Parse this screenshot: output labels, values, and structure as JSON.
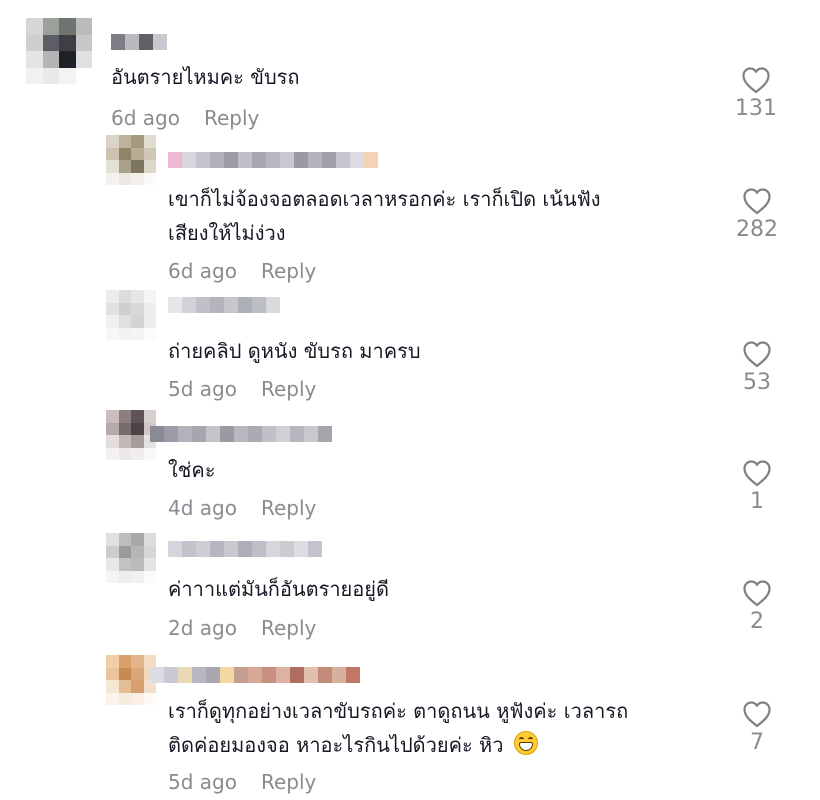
{
  "comments": [
    {
      "text_lines": [
        "อันตรายไหมคะ ขับรถ"
      ],
      "time": "6d ago",
      "reply_label": "Reply",
      "likes": "131",
      "avatar_colors": [
        "#d6d6d6",
        "#9aa09a",
        "#6f7470",
        "#b9bcb9",
        "#cfcfcf",
        "#5d5d66",
        "#3d3f45",
        "#c8c8c8",
        "#e4e4e4",
        "#b4b4b4",
        "#1f2128",
        "#e0e0e0",
        "#f1f1f1",
        "#e9e9e9",
        "#f3f3f3",
        "#ffffff"
      ],
      "name_colors": [
        "#7d7d86",
        "#b9b9c0",
        "#5f6068",
        "#c8c8ce"
      ]
    },
    {
      "text_lines": [
        "เขาก็ไม่จ้องจอตลอดเวลาหรอกค่ะ เราก็เปิด เน้นฟัง",
        "เสียงให้ไม่ง่วง"
      ],
      "time": "6d ago",
      "reply_label": "Reply",
      "likes": "282",
      "avatar_colors": [
        "#d9d3c8",
        "#bdb39d",
        "#a49a80",
        "#e2dcd0",
        "#cbc3b0",
        "#8f8468",
        "#b7ad94",
        "#d0c8b6",
        "#e6e1d6",
        "#a9a08a",
        "#7d7560",
        "#ddd7ca",
        "#f4f2ee",
        "#ece9e2",
        "#f2efea",
        "#fafaf8"
      ],
      "name_colors": [
        "#efb8d2",
        "#d6d6dc",
        "#c4c4cc",
        "#b0b0b8",
        "#9c9ca6",
        "#c0c0c8",
        "#a8a8b2",
        "#b8b8c0",
        "#c8c8d0",
        "#9a9aa4",
        "#b4b4bc",
        "#a0a0aa",
        "#c6c6ce",
        "#dcdce2",
        "#f2d3b6"
      ]
    },
    {
      "text_lines": [
        "ถ่ายคลิป ดูหนัง ขับรถ มาครบ"
      ],
      "time": "5d ago",
      "reply_label": "Reply",
      "likes": "53",
      "avatar_colors": [
        "#ededed",
        "#dcdcdc",
        "#e6e6e6",
        "#f4f4f4",
        "#e2e2e2",
        "#cfcfcf",
        "#d8d8d8",
        "#ececec",
        "#f0f0f0",
        "#e0e0e0",
        "#d4d4d4",
        "#eeeeee",
        "#f7f7f7",
        "#f2f2f2",
        "#f5f5f5",
        "#fbfbfb"
      ],
      "name_colors": [
        "#e6e6ea",
        "#d2d2d8",
        "#c0c0c8",
        "#b4b4bc",
        "#c6c6cc",
        "#aeb0b8",
        "#bcbec6",
        "#dadade"
      ]
    },
    {
      "text_lines": [
        "ใช่คะ"
      ],
      "time": "4d ago",
      "reply_label": "Reply",
      "likes": "1",
      "avatar_colors": [
        "#c9c0bd",
        "#8e7f7c",
        "#5e5357",
        "#d6d0ce",
        "#b4aaa8",
        "#7a6c6b",
        "#4b4348",
        "#cfc8c6",
        "#e3dedd",
        "#c2b8b6",
        "#a79c9b",
        "#e6e2e1",
        "#f4f1f1",
        "#ece8e7",
        "#f0eded",
        "#faf9f9"
      ],
      "name_colors": [
        "#8a8a94",
        "#9c9ca6",
        "#b2b2ba",
        "#a6a6ae",
        "#c4c4ca",
        "#9a9aa2",
        "#b8b8c0",
        "#aaaab2",
        "#c0c0c8",
        "#d0d0d6",
        "#b6b6be",
        "#c8c8ce",
        "#a4a4ac"
      ]
    },
    {
      "text_lines": [
        "ค่าาาแต่มันก็อันตรายอยู่ดี"
      ],
      "time": "2d ago",
      "reply_label": "Reply",
      "likes": "2",
      "avatar_colors": [
        "#e0e0e0",
        "#bdbdbd",
        "#a9a9a9",
        "#dcdcdc",
        "#cdcdcd",
        "#9a9a9a",
        "#b6b6b6",
        "#d6d6d6",
        "#e8e8e8",
        "#c2c2c2",
        "#bcbcbc",
        "#e4e4e4",
        "#f4f4f4",
        "#eeeeee",
        "#f1f1f1",
        "#fafafa"
      ],
      "name_colors": [
        "#d4d4da",
        "#c2c2ca",
        "#cdcdd3",
        "#b6b6be",
        "#c8c8ce",
        "#aeaeb6",
        "#bebec6",
        "#d6d6dc",
        "#cacad0",
        "#dcdce2",
        "#c4c4cc"
      ]
    },
    {
      "text_lines": [
        "เราก็ดูทุกอย่างเวลาขับรถค่ะ ตาดูถนน หูฟังค่ะ เวลารถ",
        "ติดค่อยมองจอ หาอะไรกินไปด้วยค่ะ หิว"
      ],
      "time": "5d ago",
      "reply_label": "Reply",
      "likes": "7",
      "emoji": "grinning-face",
      "avatar_colors": [
        "#f0cfa8",
        "#d9a06a",
        "#e2b48a",
        "#f4dcc2",
        "#ebc39c",
        "#c88a55",
        "#d8a678",
        "#f1d6bb",
        "#f6e6d4",
        "#e3bd96",
        "#d6a070",
        "#f4e0ca",
        "#fbf3ea",
        "#f7ebdd",
        "#f9efe4",
        "#fdf9f4"
      ],
      "name_colors": [
        "#dcdce4",
        "#c9c9d2",
        "#e8d8b6",
        "#b8b8c2",
        "#a8a8b2",
        "#f3d7a4",
        "#c4a090",
        "#d7a896",
        "#c98f80",
        "#dcb2a2",
        "#b06e60",
        "#e2c0b0",
        "#c48a78",
        "#d7b0a0",
        "#c07766"
      ]
    }
  ],
  "icons": {
    "like": "heart-outline-icon"
  },
  "colors": {
    "text": "#161823",
    "secondary": "#8a8b91",
    "heart_stroke": "#7f8087"
  }
}
